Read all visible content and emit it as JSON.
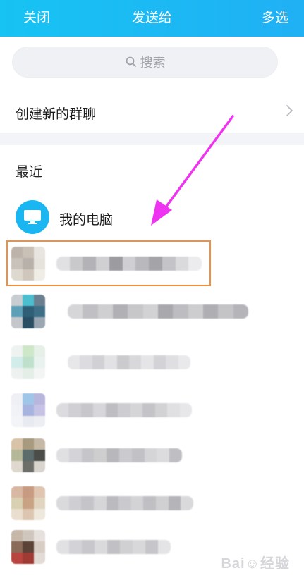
{
  "header": {
    "close_label": "关闭",
    "title": "发送给",
    "multi_select_label": "多选",
    "gradient_start": "#17c3f3",
    "gradient_end": "#20b0f4"
  },
  "search": {
    "placeholder": "搜索",
    "icon": "search-icon"
  },
  "create_group": {
    "label": "创建新的群聊",
    "icon": "chevron-right-icon"
  },
  "recent": {
    "section_title": "最近"
  },
  "my_computer": {
    "label": "我的电脑",
    "icon": "monitor-icon",
    "avatar_color": "#1ab6f2"
  },
  "highlight_color": "#f28f3b",
  "arrow_color": "#ee34f0",
  "watermark": {
    "text": "Bai",
    "suffix": "经验"
  },
  "contacts": [
    {
      "name": "",
      "avatar_colors": [
        "#bdb3a8",
        "#c9c1b5",
        "#e8e5e0",
        "#c8c2b9",
        "#b7b1a9",
        "#e6e3dd",
        "#ded9cf",
        "#cfc7bc",
        "#f0ece6"
      ],
      "bar_colors": [
        "#e1e1e4",
        "#c9c9cc",
        "#b3b3b7",
        "#d0d0d3",
        "#9c9ca0",
        "#cfcfd3",
        "#b9b9bd",
        "#a4a4a8",
        "#c4c4c8",
        "#dadadd",
        "#ececef"
      ]
    },
    {
      "name": "",
      "avatar_colors": [
        "#c9ccd1",
        "#4bbfd0",
        "#6b7f90",
        "#5ea0b7",
        "#2e5f77",
        "#3e6f87",
        "#c3c6cb",
        "#2a4e64",
        "#9aa7b2"
      ],
      "bar_colors": [
        "#d6d6d9",
        "#c0c0c4",
        "#cfcfd2",
        "#b1b1b5",
        "#c7c7ca",
        "#d2d2d5",
        "#a9a9ad",
        "#bdbdc1",
        "#cdcdd0",
        "#afafb3",
        "#c4c4c7",
        "#b5b5b9"
      ]
    },
    {
      "name": "",
      "avatar_colors": [
        "#eef3f1",
        "#cde7c8",
        "#e6efe8",
        "#d2ecea",
        "#bfe1cc",
        "#e9f2ef",
        "#edf2f0",
        "#e3eee7",
        "#f3f5f4"
      ],
      "bar_colors": [
        "#e7e7ea",
        "#dcdce0",
        "#d1d1d5",
        "#e2e2e5",
        "#cbcbce",
        "#d8d8db",
        "#e5e5e8",
        "#d3d3d7",
        "#dfdfe2",
        "#e9e9ec"
      ]
    },
    {
      "name": "",
      "avatar_colors": [
        "#eef0f5",
        "#9fc6e8",
        "#b9b6de",
        "#f1f2f6",
        "#a8b4e0",
        "#c6c2e6",
        "#f3f4f7",
        "#e8eaf1",
        "#eceef3"
      ],
      "bar_colors": [
        "#dcdce0",
        "#d0d0d4",
        "#c7c7cb",
        "#d7d7db",
        "#bebec2",
        "#cdcdd1",
        "#d5d5d8",
        "#c4c4c8",
        "#d2d2d5",
        "#e0e0e3",
        "#e7e7ea"
      ]
    },
    {
      "name": "",
      "avatar_colors": [
        "#d9c3a8",
        "#a79a7f",
        "#c5b9a6",
        "#b5b898",
        "#5c6b6c",
        "#4a4d48",
        "#dfd8cf",
        "#6d6f6a",
        "#d9d4cd"
      ],
      "bar_colors": [
        "#e0e0e3",
        "#d4d4d8",
        "#c6c6ca",
        "#cececf",
        "#b8b8bc",
        "#cbcbcf",
        "#c2c2c6",
        "#d5d5d8",
        "#dcdcdf",
        "#bfbfc3"
      ]
    },
    {
      "name": "",
      "avatar_colors": [
        "#d8b8a3",
        "#c79a81",
        "#e0c6b1",
        "#d9cfb1",
        "#c9a283",
        "#e2d5c0",
        "#eadfce",
        "#dcc6b1",
        "#efe8dd"
      ],
      "bar_colors": [
        "#dadadd",
        "#cfcfd3",
        "#c5c5c9",
        "#d6d6d9",
        "#bbbbbf",
        "#cacace",
        "#d3d3d6",
        "#c0c0c4",
        "#d0d0d3",
        "#b5b5b9",
        "#d9d9dc"
      ]
    },
    {
      "name": "",
      "avatar_colors": [
        "#c7b7a9",
        "#cfc6bd",
        "#e6e1dc",
        "#8a6a58",
        "#5b4338",
        "#d8cdc5",
        "#b8453f",
        "#a03a35",
        "#e2dbd5"
      ],
      "bar_colors": [
        "#e1e1e4",
        "#d3d3d7",
        "#c8c8cc",
        "#dadadd",
        "#c1c1c5",
        "#d0d0d3",
        "#d8d8db",
        "#c6c6ca",
        "#e4e4e7"
      ]
    }
  ]
}
